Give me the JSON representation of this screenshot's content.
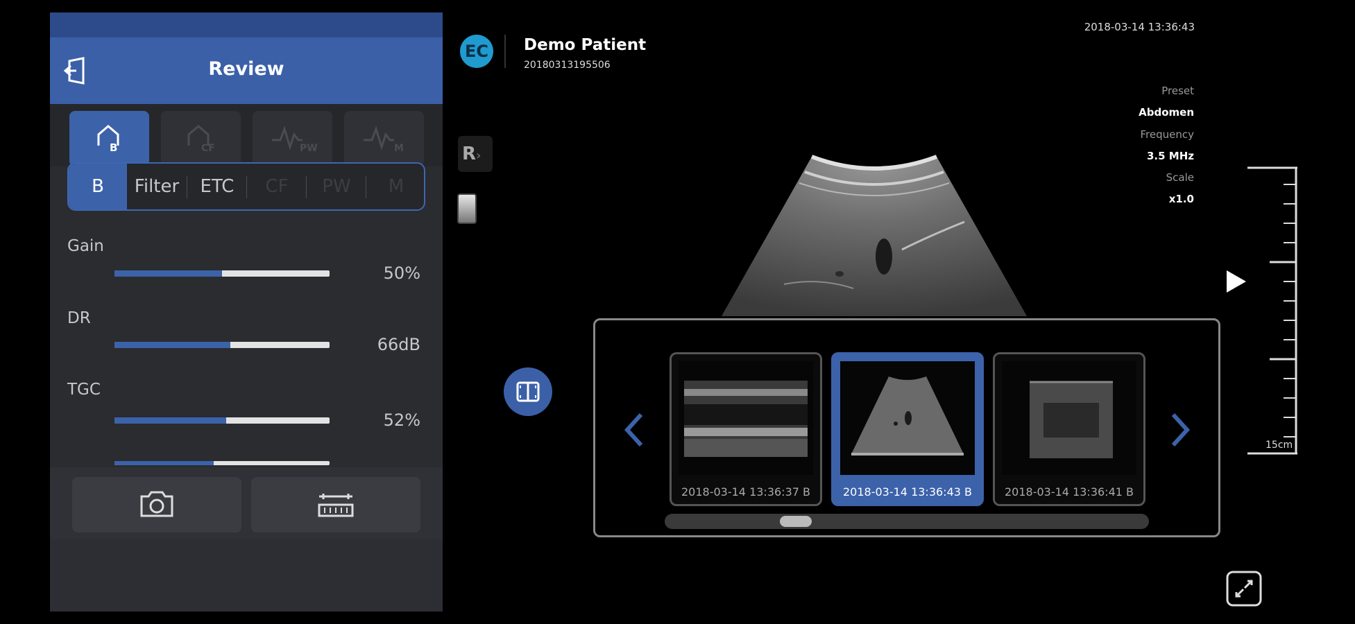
{
  "panel": {
    "title": "Review",
    "icons": {
      "back": "exit-review-icon"
    },
    "modes": [
      {
        "name": "B",
        "icon": "b-mode-icon",
        "active": true
      },
      {
        "name": "CF",
        "icon": "cf-mode-icon",
        "active": false
      },
      {
        "name": "PW",
        "icon": "pw-mode-icon",
        "active": false
      },
      {
        "name": "M",
        "icon": "m-mode-icon",
        "active": false
      }
    ],
    "subtabs": [
      {
        "label": "B",
        "state": "active"
      },
      {
        "label": "Filter",
        "state": "normal"
      },
      {
        "label": "ETC",
        "state": "normal"
      },
      {
        "label": "CF",
        "state": "disabled"
      },
      {
        "label": "PW",
        "state": "disabled"
      },
      {
        "label": "M",
        "state": "disabled"
      }
    ],
    "params": [
      {
        "label": "Gain",
        "value": "50%",
        "level": 0.5
      },
      {
        "label": "DR",
        "value": "66dB",
        "level": 0.54
      },
      {
        "label": "TGC",
        "value": "52%",
        "level": 0.52
      }
    ],
    "tools": {
      "capture_icon": "camera-icon",
      "measure_icon": "ruler-icon"
    }
  },
  "patient": {
    "logo": "EC",
    "name": "Demo Patient",
    "id": "20180313195506"
  },
  "datetime": "2018-03-14 13:36:43",
  "meta": [
    {
      "label": "Preset",
      "value": "Abdomen"
    },
    {
      "label": "Frequency",
      "value": "3.5 MHz"
    },
    {
      "label": "Scale",
      "value": "x1.0"
    }
  ],
  "orientation": {
    "label": "R"
  },
  "depth": {
    "label": "15cm"
  },
  "review": {
    "thumbnails": [
      {
        "caption": "2018-03-14 13:36:37 B",
        "selected": false
      },
      {
        "caption": "2018-03-14 13:36:43 B",
        "selected": true
      },
      {
        "caption": "2018-03-14 13:36:41 B",
        "selected": false
      }
    ],
    "scroll_position": 0.24
  },
  "colors": {
    "accent": "#3c62aa",
    "panel": "#2a2c30",
    "logo": "#1f9bcf"
  }
}
